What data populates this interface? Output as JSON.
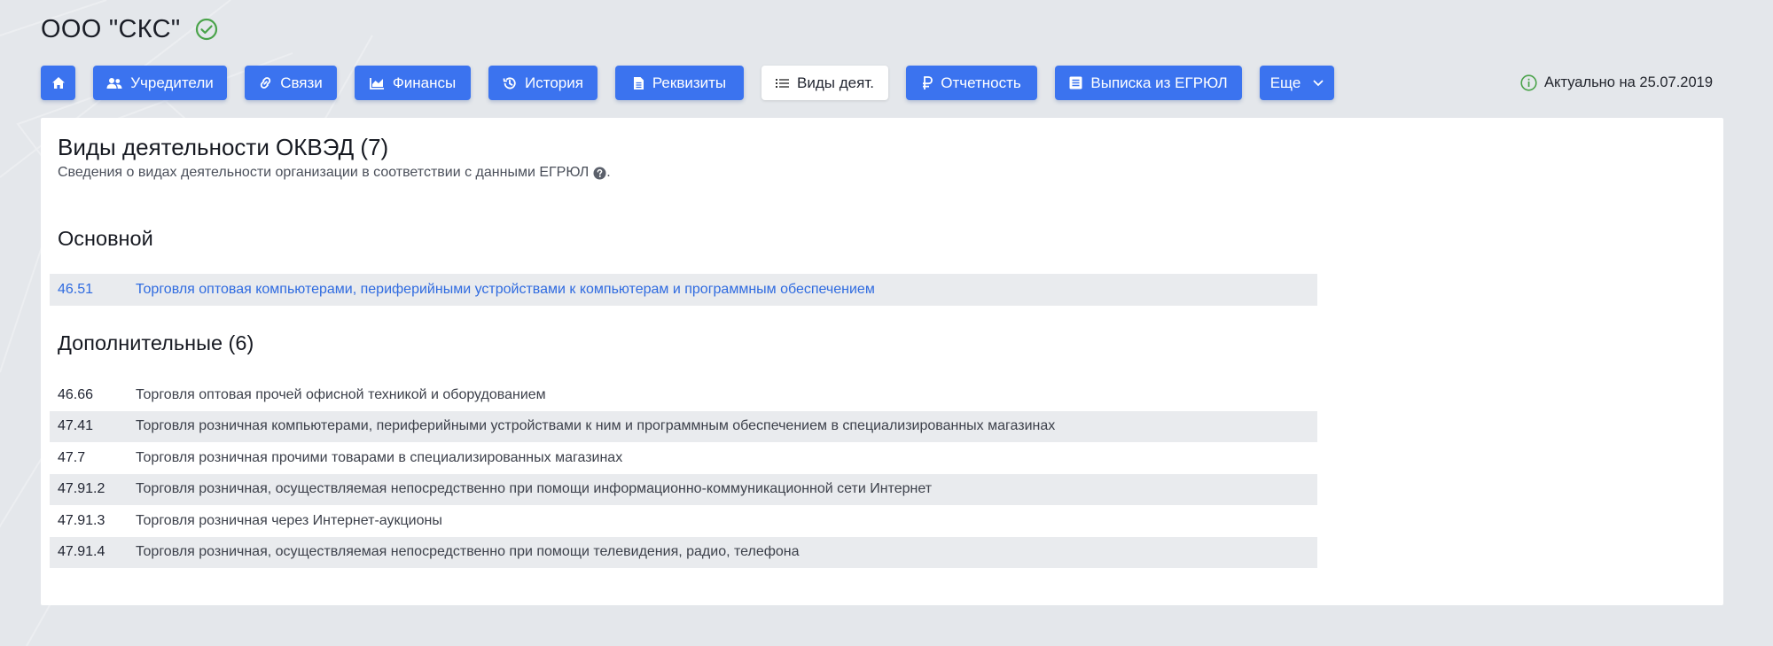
{
  "company": {
    "name": "ООО \"СКС\"",
    "verified_icon": "check-circle-icon",
    "verified_color": "#4aa34a"
  },
  "tabs": [
    {
      "label": "",
      "icon": "home-icon",
      "active": false
    },
    {
      "label": "Учредители",
      "icon": "users-icon",
      "active": false
    },
    {
      "label": "Связи",
      "icon": "link-icon",
      "active": false
    },
    {
      "label": "Финансы",
      "icon": "chart-icon",
      "active": false
    },
    {
      "label": "История",
      "icon": "history-icon",
      "active": false
    },
    {
      "label": "Реквизиты",
      "icon": "document-icon",
      "active": false
    },
    {
      "label": "Виды деят.",
      "icon": "list-icon",
      "active": true
    },
    {
      "label": "Отчетность",
      "icon": "ruble-icon",
      "active": false
    },
    {
      "label": "Выписка из ЕГРЮЛ",
      "icon": "register-icon",
      "active": false
    },
    {
      "label": "Еще",
      "icon": "chevron-down-icon",
      "active": false
    }
  ],
  "status": {
    "actual_text": "Актуально на 25.07.2019",
    "icon": "info-icon"
  },
  "section": {
    "title": "Виды деятельности ОКВЭД (7)",
    "subtitle": "Сведения о видах деятельности организации в соответствии с данными ЕГРЮЛ",
    "subtitle_suffix": "."
  },
  "main_group": {
    "title": "Основной",
    "rows": [
      {
        "code": "46.51",
        "desc": "Торговля оптовая компьютерами, периферийными устройствами к компьютерам и программным обеспечением"
      }
    ]
  },
  "extra_group": {
    "title": "Дополнительные (6)",
    "rows": [
      {
        "code": "46.66",
        "desc": "Торговля оптовая прочей офисной техникой и оборудованием"
      },
      {
        "code": "47.41",
        "desc": "Торговля розничная компьютерами, периферийными устройствами к ним и программным обеспечением в специализированных магазинах"
      },
      {
        "code": "47.7",
        "desc": "Торговля розничная прочими товарами в специализированных магазинах"
      },
      {
        "code": "47.91.2",
        "desc": "Торговля розничная, осуществляемая непосредственно при помощи информационно-коммуникационной сети Интернет"
      },
      {
        "code": "47.91.3",
        "desc": "Торговля розничная через Интернет-аукционы"
      },
      {
        "code": "47.91.4",
        "desc": "Торговля розничная, осуществляемая непосредственно при помощи телевидения, радио, телефона"
      }
    ]
  },
  "colors": {
    "accent": "#3b73ef",
    "link": "#2f6be0",
    "background": "#e4e7eb",
    "stripe": "#e9ebee"
  }
}
